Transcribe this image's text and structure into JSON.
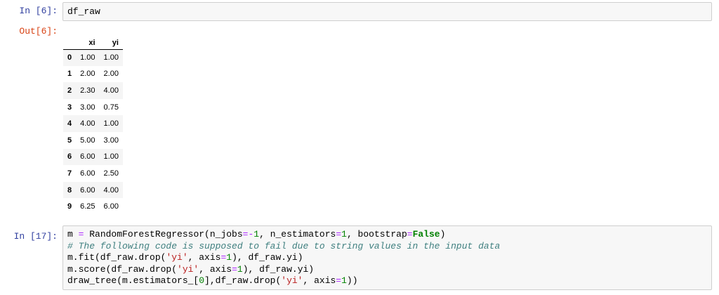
{
  "cells": [
    {
      "prompt": "In [6]:",
      "code": "df_raw"
    },
    {
      "prompt": "Out[6]:"
    },
    {
      "prompt": "In [17]:"
    }
  ],
  "table": {
    "columns": [
      "",
      "xi",
      "yi"
    ],
    "rows": [
      {
        "index": "0",
        "xi": "1.00",
        "yi": "1.00"
      },
      {
        "index": "1",
        "xi": "2.00",
        "yi": "2.00"
      },
      {
        "index": "2",
        "xi": "2.30",
        "yi": "4.00"
      },
      {
        "index": "3",
        "xi": "3.00",
        "yi": "0.75"
      },
      {
        "index": "4",
        "xi": "4.00",
        "yi": "1.00"
      },
      {
        "index": "5",
        "xi": "5.00",
        "yi": "3.00"
      },
      {
        "index": "6",
        "xi": "6.00",
        "yi": "1.00"
      },
      {
        "index": "7",
        "xi": "6.00",
        "yi": "2.50"
      },
      {
        "index": "8",
        "xi": "6.00",
        "yi": "4.00"
      },
      {
        "index": "9",
        "xi": "6.25",
        "yi": "6.00"
      }
    ]
  },
  "code17": {
    "l1": {
      "a": "m ",
      "b": "=",
      "c": " RandomForestRegressor(n_jobs",
      "d": "=-",
      "e": "1",
      "f": ", n_estimators",
      "g": "=",
      "h": "1",
      "i": ", bootstrap",
      "j": "=",
      "k": "False",
      "l": ")"
    },
    "l2": "# The following code is supposed to fail due to string values in the input data",
    "l3": {
      "a": "m.fit(df_raw.drop(",
      "b": "'yi'",
      "c": ", axis",
      "d": "=",
      "e": "1",
      "f": "), df_raw.yi)"
    },
    "l4": {
      "a": "m.score(df_raw.drop(",
      "b": "'yi'",
      "c": ", axis",
      "d": "=",
      "e": "1",
      "f": "), df_raw.yi)"
    },
    "l5": {
      "a": "draw_tree(m.estimators_[",
      "b": "0",
      "c": "],df_raw.drop(",
      "d": "'yi'",
      "e": ", axis",
      "f": "=",
      "g": "1",
      "h": "))"
    }
  }
}
